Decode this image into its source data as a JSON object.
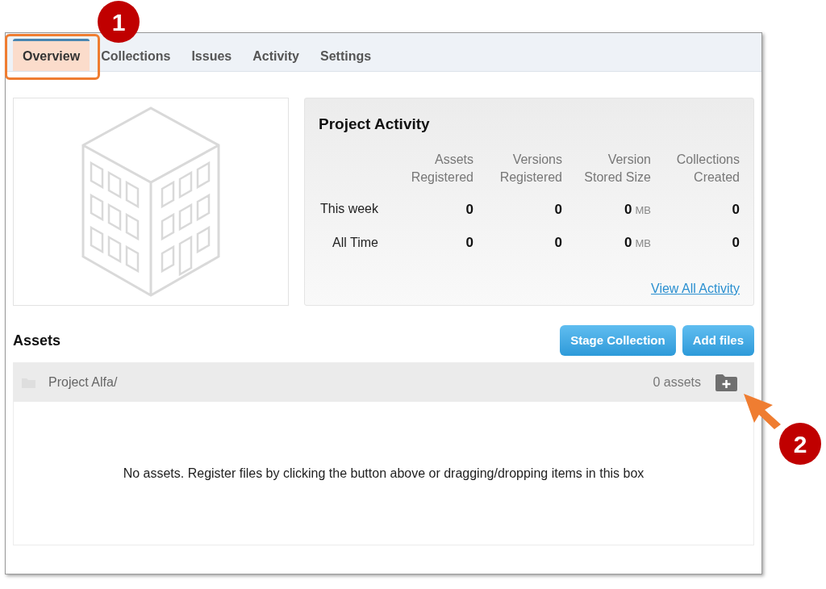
{
  "tabs": [
    {
      "label": "Overview",
      "selected": true
    },
    {
      "label": "Collections",
      "selected": false
    },
    {
      "label": "Issues",
      "selected": false
    },
    {
      "label": "Activity",
      "selected": false
    },
    {
      "label": "Settings",
      "selected": false
    }
  ],
  "project_activity": {
    "title": "Project Activity",
    "columns": [
      "Assets Registered",
      "Versions Registered",
      "Version Stored Size",
      "Collections Created"
    ],
    "rows": [
      {
        "label": "This week",
        "cells": [
          {
            "value": "0"
          },
          {
            "value": "0"
          },
          {
            "value": "0",
            "unit": "MB"
          },
          {
            "value": "0"
          }
        ]
      },
      {
        "label": "All Time",
        "cells": [
          {
            "value": "0"
          },
          {
            "value": "0"
          },
          {
            "value": "0",
            "unit": "MB"
          },
          {
            "value": "0"
          }
        ]
      }
    ],
    "link": "View All Activity"
  },
  "assets": {
    "title": "Assets",
    "buttons": [
      "Stage Collection",
      "Add files"
    ],
    "folder": {
      "name": "Project Alfa/",
      "count": "0 assets"
    },
    "empty_message": "No assets. Register files by clicking the button above or dragging/dropping items in this box"
  },
  "annotations": [
    {
      "kind": "callout",
      "label": "1"
    },
    {
      "kind": "callout",
      "label": "2"
    }
  ]
}
